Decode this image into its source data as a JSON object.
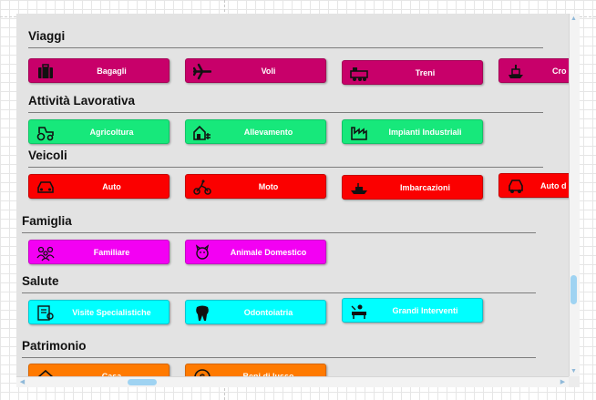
{
  "sections": [
    {
      "title": "Viaggi",
      "items": [
        {
          "label": "Bagagli",
          "icon": "luggage-icon"
        },
        {
          "label": "Voli",
          "icon": "airplane-icon"
        },
        {
          "label": "Treni",
          "icon": "train-icon"
        },
        {
          "label": "Cro",
          "icon": "cruise-ship-icon"
        }
      ]
    },
    {
      "title": "Attività Lavorativa",
      "items": [
        {
          "label": "Agricoltura",
          "icon": "tractor-icon"
        },
        {
          "label": "Allevamento",
          "icon": "farm-barn-icon"
        },
        {
          "label": "Impianti Industriali",
          "icon": "factory-icon"
        }
      ]
    },
    {
      "title": "Veicoli",
      "items": [
        {
          "label": "Auto",
          "icon": "car-icon"
        },
        {
          "label": "Moto",
          "icon": "motorcycle-icon"
        },
        {
          "label": "Imbarcazioni",
          "icon": "boat-icon"
        },
        {
          "label": "Auto d",
          "icon": "vintage-car-icon"
        }
      ]
    },
    {
      "title": "Famiglia",
      "items": [
        {
          "label": "Familiare",
          "icon": "family-icon"
        },
        {
          "label": "Animale Domestico",
          "icon": "pet-icon"
        }
      ]
    },
    {
      "title": "Salute",
      "items": [
        {
          "label": "Visite Specialistiche",
          "icon": "medical-record-icon"
        },
        {
          "label": "Odontoiatria",
          "icon": "tooth-icon"
        },
        {
          "label": "Grandi Interventi",
          "icon": "surgery-icon"
        }
      ]
    },
    {
      "title": "Patrimonio",
      "items": [
        {
          "label": "Casa",
          "icon": "house-icon"
        },
        {
          "label": "Beni di lusso",
          "icon": "money-icon"
        }
      ]
    }
  ],
  "colors": {
    "viaggi": "#c8006a",
    "attivita": "#17e87b",
    "veicoli": "#fb0000",
    "famiglia": "#f300f3",
    "salute": "#00ffff",
    "patrimonio": "#ff7a00"
  },
  "scrollbars": {
    "up_arrow": "▲",
    "down_arrow": "▼",
    "left_arrow": "◀",
    "right_arrow": "▶"
  }
}
